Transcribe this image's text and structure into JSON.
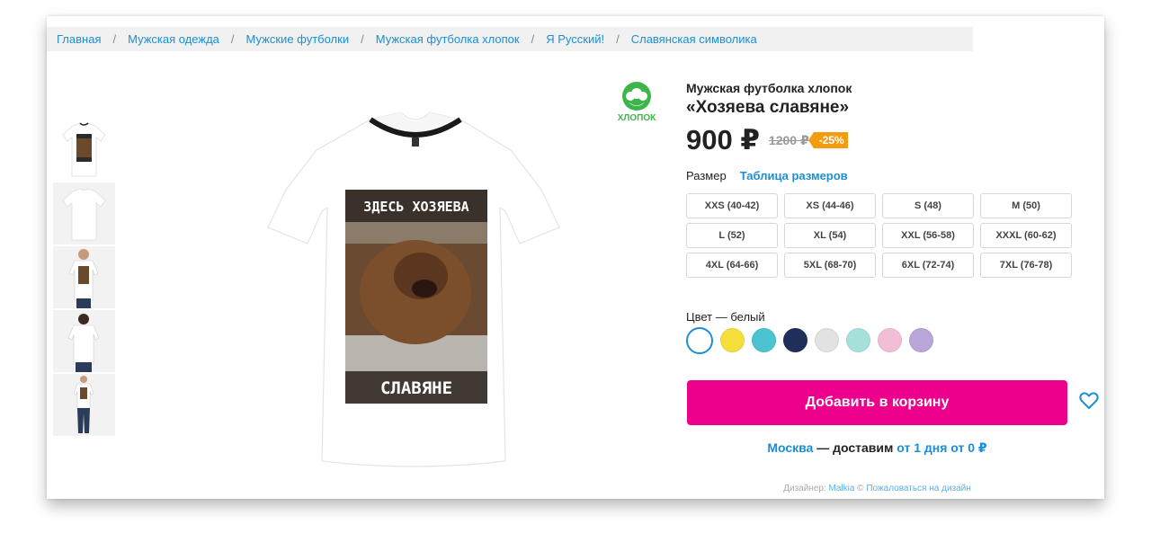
{
  "breadcrumb": [
    {
      "label": "Главная"
    },
    {
      "label": "Мужская одежда"
    },
    {
      "label": "Мужские футболки"
    },
    {
      "label": "Мужская футболка хлопок"
    },
    {
      "label": "Я Русский!"
    },
    {
      "label": "Славянская символика"
    }
  ],
  "breadcrumb_sep": "/",
  "badge": {
    "label": "ХЛОПОК",
    "icon": "cotton-icon",
    "color": "#3db54a"
  },
  "print": {
    "top_text": "ЗДЕСЬ ХОЗЯЕВА",
    "bottom_text": "СЛАВЯНЕ"
  },
  "product": {
    "type": "Мужская футболка хлопок",
    "title": "«Хозяева славяне»",
    "price": "900 ₽",
    "old_price": "1200 ₽",
    "discount": "-25%"
  },
  "size": {
    "label": "Размер",
    "chart_link": "Таблица размеров",
    "options": [
      "XXS (40-42)",
      "XS (44-46)",
      "S (48)",
      "M (50)",
      "L (52)",
      "XL (54)",
      "XXL (56-58)",
      "XXXL (60-62)",
      "4XL (64-66)",
      "5XL (68-70)",
      "6XL (72-74)",
      "7XL (76-78)"
    ]
  },
  "color": {
    "label": "Цвет — белый",
    "swatches": [
      "#ffffff",
      "#f5dd3a",
      "#4cc3d0",
      "#1f2f5a",
      "#e2e2e2",
      "#a7e1dc",
      "#f2bdd6",
      "#b8a6d9"
    ]
  },
  "cart_button": "Добавить в корзину",
  "delivery": {
    "city": "Москва",
    "middle": " — доставим ",
    "term": "от 1 дня от 0 ₽"
  },
  "designer": {
    "prefix": "Дизайнер: ",
    "name": "Malkia",
    "copy": " © ",
    "report": "Пожаловаться на дизайн"
  },
  "colors": {
    "accent": "#ec008c",
    "link": "#1a8fd6",
    "discount": "#f39c12",
    "cotton": "#3db54a"
  }
}
